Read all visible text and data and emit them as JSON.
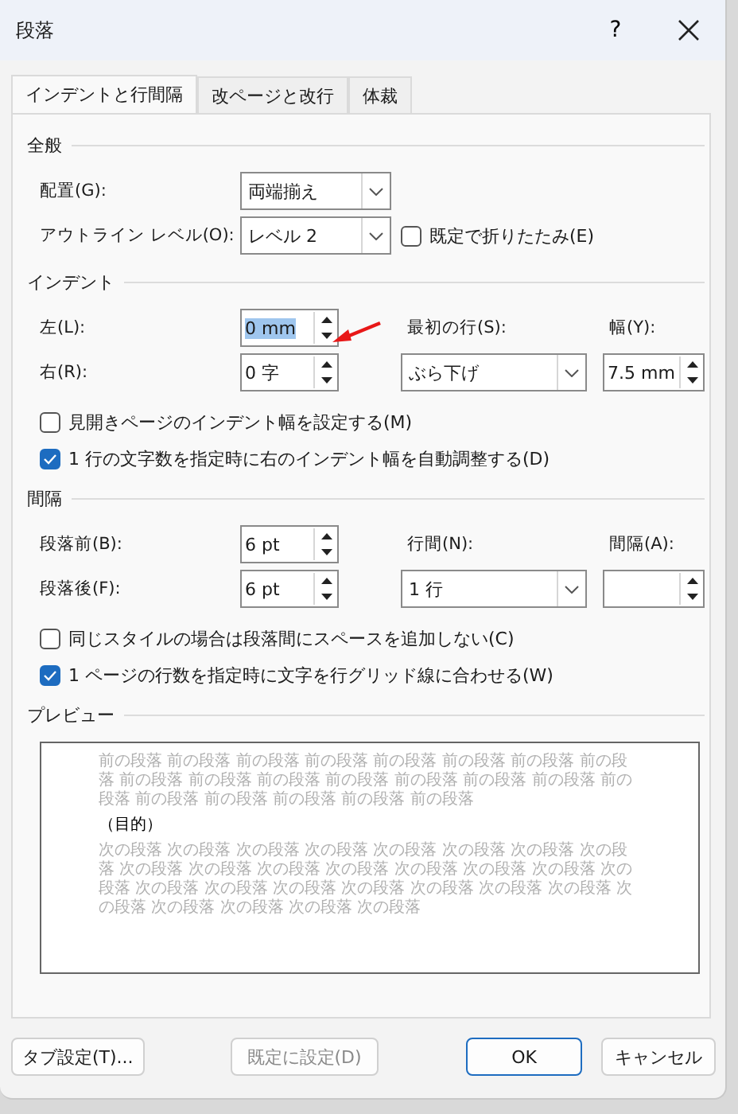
{
  "window": {
    "title": "段落",
    "help": "?"
  },
  "tabs": [
    {
      "label": "インデントと行間隔",
      "selected": true
    },
    {
      "label": "改ページと改行",
      "selected": false
    },
    {
      "label": "体裁",
      "selected": false
    }
  ],
  "sections": [
    {
      "heading": "全般",
      "rows": [
        {
          "cells": [
            {
              "kind": "label",
              "text": "配置(G):"
            },
            {
              "kind": "select-wide",
              "value": "両端揃え"
            }
          ]
        },
        {
          "cells": [
            {
              "kind": "label",
              "text": "アウトライン レベル(O):"
            },
            {
              "kind": "select-wide",
              "value": "レベル 2"
            },
            {
              "kind": "checkbox",
              "text": "既定で折りたたみ(E)",
              "checked": false
            }
          ]
        }
      ]
    },
    {
      "heading": "インデント",
      "rows": [
        {
          "cells": [
            {
              "kind": "label",
              "text": "左(L):"
            },
            {
              "kind": "spin",
              "value": "0 mm",
              "highlighted": true
            },
            {
              "kind": "label",
              "text": "最初の行(S):"
            },
            {
              "kind": "label",
              "text": "幅(Y):"
            }
          ]
        },
        {
          "cells": [
            {
              "kind": "label",
              "text": "右(R):"
            },
            {
              "kind": "spin",
              "value": "0 字"
            },
            {
              "kind": "select",
              "value": "ぶら下げ"
            },
            {
              "kind": "spin",
              "value": "7.5 mm"
            }
          ]
        }
      ],
      "checks": [
        {
          "label": "見開きページのインデント幅を設定する(M)",
          "checked": false
        },
        {
          "label": "1 行の文字数を指定時に右のインデント幅を自動調整する(D)",
          "checked": true
        }
      ]
    },
    {
      "heading": "間隔",
      "rows": [
        {
          "cells": [
            {
              "kind": "label",
              "text": "段落前(B):"
            },
            {
              "kind": "spin",
              "value": "6 pt"
            },
            {
              "kind": "label",
              "text": "行間(N):"
            },
            {
              "kind": "label",
              "text": "間隔(A):"
            }
          ]
        },
        {
          "cells": [
            {
              "kind": "label",
              "text": "段落後(F):"
            },
            {
              "kind": "spin",
              "value": "6 pt"
            },
            {
              "kind": "select",
              "value": "1 行"
            },
            {
              "kind": "spin"
            }
          ]
        }
      ],
      "checks": [
        {
          "label": "同じスタイルの場合は段落間にスペースを追加しない(C)",
          "checked": false
        },
        {
          "label": "1 ページの行数を指定時に文字を行グリッド線に合わせる(W)",
          "checked": true
        }
      ]
    }
  ],
  "preview": {
    "heading": "プレビュー",
    "before": "前の段落 前の段落 前の段落 前の段落 前の段落 前の段落 前の段落 前の段落 前の段落 前の段落 前の段落 前の段落 前の段落 前の段落 前の段落 前の段落 前の段落 前の段落 前の段落 前の段落 前の段落",
    "sample": "（目的）",
    "after": "次の段落 次の段落 次の段落 次の段落 次の段落 次の段落 次の段落 次の段落 次の段落 次の段落 次の段落 次の段落 次の段落 次の段落 次の段落 次の段落 次の段落 次の段落 次の段落 次の段落 次の段落 次の段落 次の段落 次の段落 次の段落 次の段落 次の段落 次の段落"
  },
  "buttons": [
    {
      "label": "タブ設定(T)...",
      "kind": "normal",
      "disabled": false
    },
    {
      "label": "既定に設定(D)",
      "kind": "normal",
      "disabled": true
    },
    {
      "label": "OK",
      "kind": "default",
      "disabled": false
    },
    {
      "label": "キャンセル",
      "kind": "normal",
      "disabled": false
    }
  ]
}
